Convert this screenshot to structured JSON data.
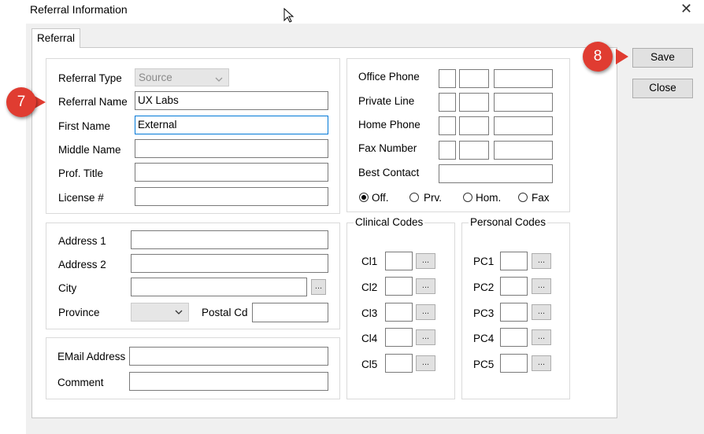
{
  "window": {
    "title": "Referral Information",
    "close_glyph": "✕"
  },
  "tabs": [
    {
      "label": "Referral"
    }
  ],
  "referral": {
    "type": {
      "label": "Referral Type",
      "value": "Source"
    },
    "name": {
      "label": "Referral Name",
      "value": "UX Labs"
    },
    "first_name": {
      "label": "First Name",
      "value": "External"
    },
    "middle_name": {
      "label": "Middle Name",
      "value": ""
    },
    "prof_title": {
      "label": "Prof. Title",
      "value": ""
    },
    "license": {
      "label": "License #",
      "value": ""
    }
  },
  "address": {
    "address1": {
      "label": "Address 1",
      "value": ""
    },
    "address2": {
      "label": "Address 2",
      "value": ""
    },
    "city": {
      "label": "City",
      "value": ""
    },
    "province": {
      "label": "Province",
      "value": ""
    },
    "postal": {
      "label": "Postal Cd",
      "value": ""
    }
  },
  "contact": {
    "email": {
      "label": "EMail Address",
      "value": ""
    },
    "comment": {
      "label": "Comment",
      "value": ""
    }
  },
  "phones": {
    "office": {
      "label": "Office Phone"
    },
    "private": {
      "label": "Private Line"
    },
    "home": {
      "label": "Home Phone"
    },
    "fax": {
      "label": "Fax Number"
    },
    "best": {
      "label": "Best Contact",
      "value": ""
    },
    "radios": [
      {
        "label": "Off.",
        "checked": true
      },
      {
        "label": "Prv.",
        "checked": false
      },
      {
        "label": "Hom.",
        "checked": false
      },
      {
        "label": "Fax",
        "checked": false
      }
    ]
  },
  "clinical": {
    "title": "Clinical Codes",
    "codes": [
      "Cl1",
      "Cl2",
      "Cl3",
      "Cl4",
      "Cl5"
    ]
  },
  "personal": {
    "title": "Personal Codes",
    "codes": [
      "PC1",
      "PC2",
      "PC3",
      "PC4",
      "PC5"
    ]
  },
  "ellipsis": "...",
  "buttons": {
    "save": "Save",
    "close": "Close"
  },
  "callouts": {
    "seven": "7",
    "eight": "8"
  },
  "colors": {
    "callout": "#e03c31",
    "focus_border": "#0078d7"
  }
}
